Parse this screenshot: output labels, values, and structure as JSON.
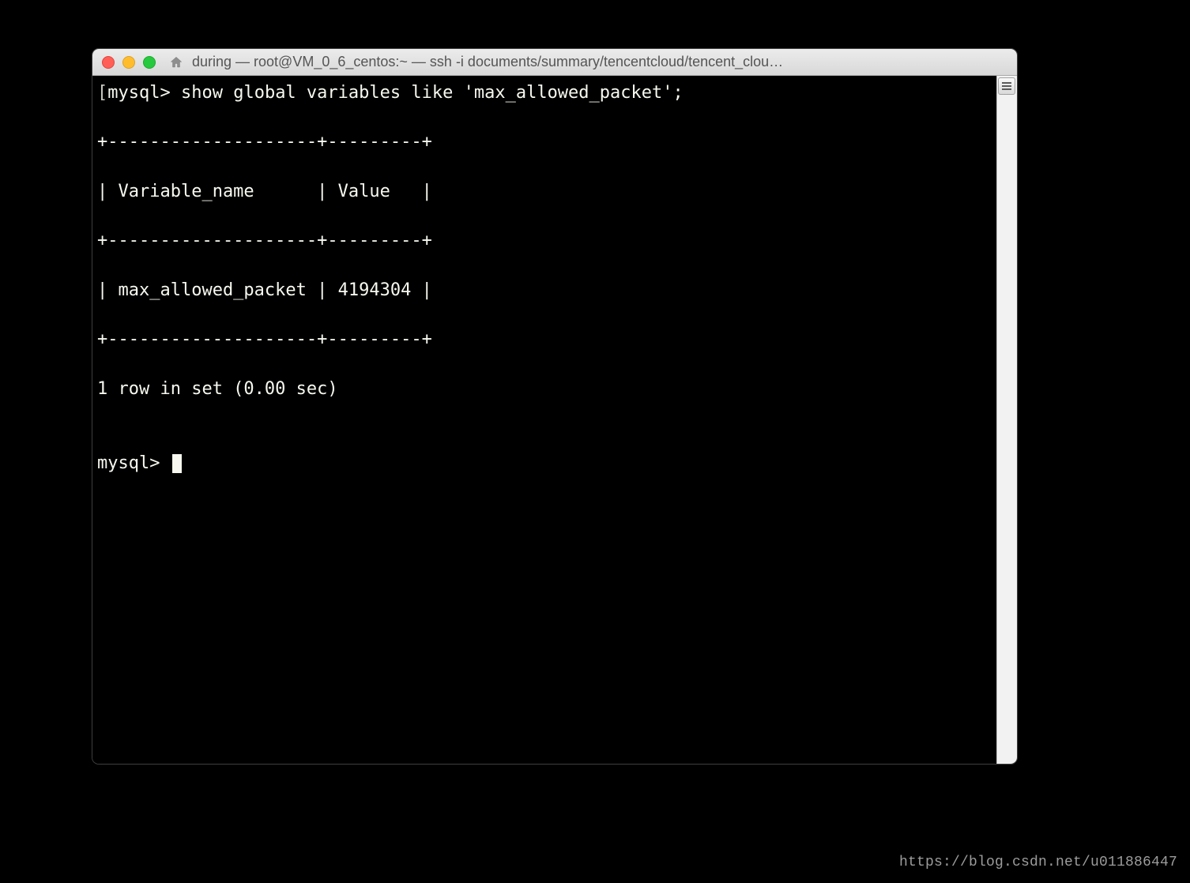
{
  "window": {
    "title": "during — root@VM_0_6_centos:~ — ssh -i documents/summary/tencentcloud/tencent_clou…"
  },
  "terminal": {
    "prompt": "mysql>",
    "command": "show global variables like 'max_allowed_packet';",
    "table": {
      "divider": "+--------------------+---------+",
      "header_row": "| Variable_name      | Value   |",
      "data_row": "| max_allowed_packet | 4194304 |"
    },
    "summary": "1 row in set (0.00 sec)",
    "prompt2": "mysql> "
  },
  "watermark": "https://blog.csdn.net/u011886447"
}
